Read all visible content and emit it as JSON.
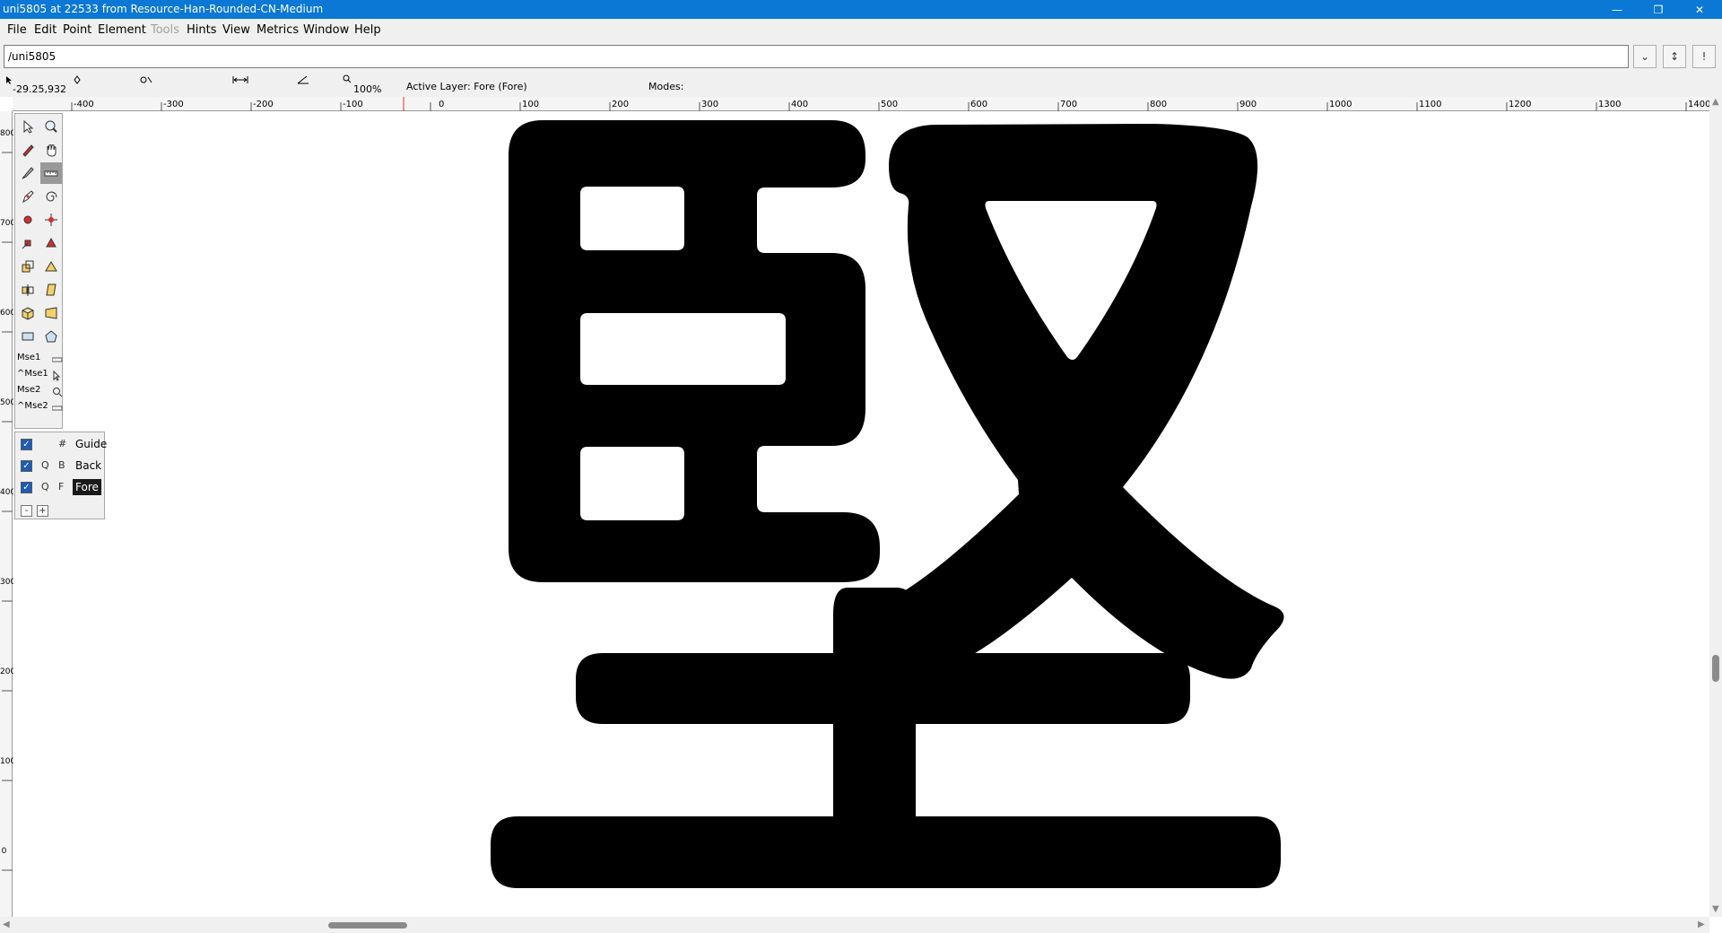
{
  "window": {
    "title": "uni5805 at 22533 from Resource-Han-Rounded-CN-Medium",
    "minimize_glyph": "—",
    "restore_glyph": "❐",
    "close_glyph": "✕"
  },
  "menu": [
    "File",
    "Edit",
    "Point",
    "Element",
    "Tools",
    "Hints",
    "View",
    "Metrics",
    "Window",
    "Help"
  ],
  "menu_disabled": [
    "Tools"
  ],
  "glyph_field": {
    "value": "/uni5805",
    "dropdown_glyph": "⌄",
    "prev_glyph": "↕",
    "next_glyph": "!"
  },
  "info": {
    "coords": "-29.25,932",
    "zoom": "100%",
    "active_layer": "Active Layer: Fore (Fore)",
    "modes": "Modes:"
  },
  "ruler": {
    "horizontal": [
      "-400",
      "-300",
      "-200",
      "-100",
      "0",
      "100",
      "200",
      "300",
      "400",
      "500",
      "600",
      "700",
      "800",
      "900",
      "1000",
      "1100",
      "1200",
      "1300",
      "1400"
    ],
    "vertical": [
      "800",
      "700",
      "600",
      "500",
      "400",
      "300",
      "200",
      "100",
      "0"
    ]
  },
  "tools": {
    "mouse_labels": [
      "Mse1",
      "^Mse1",
      "Mse2",
      "^Mse2"
    ]
  },
  "layers": [
    {
      "flag1": "#",
      "flag2": "",
      "name": "Guide"
    },
    {
      "flag1": "Q",
      "flag2": "B",
      "name": "Back"
    },
    {
      "flag1": "Q",
      "flag2": "F",
      "name": "Fore"
    }
  ],
  "layer_buttons": {
    "remove": "-",
    "add": "+"
  },
  "glyph": {
    "character": "堅",
    "fill_color": "#000000"
  }
}
